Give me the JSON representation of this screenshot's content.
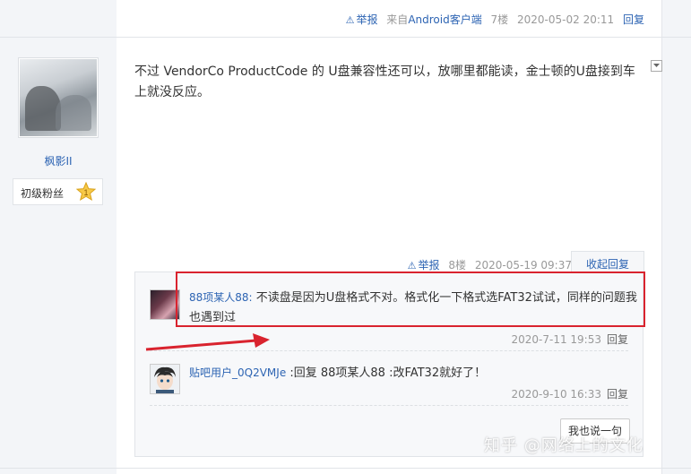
{
  "floor7": {
    "report": "举报",
    "source_prefix": "来自",
    "source_client": "Android客户端",
    "floor": "7楼",
    "time": "2020-05-02 20:11",
    "reply": "回复"
  },
  "post": {
    "user": {
      "name": "枫影II",
      "level": "初级粉丝",
      "level_num": "1"
    },
    "content": "不过 VendorCo ProductCode 的 U盘兼容性还可以，放哪里都能读，金士顿的U盘接到车上就没反应。",
    "report": "举报",
    "floor": "8楼",
    "time": "2020-05-19 09:37",
    "collapse": "收起回复"
  },
  "replies": [
    {
      "user": "88项某人88:",
      "text": " 不读盘是因为U盘格式不对。格式化一下格式选FAT32试试，同样的问题我也遇到过",
      "time": "2020-7-11 19:53",
      "action": "回复"
    },
    {
      "user": "贴吧用户_0Q2VMJe",
      "text": " :回复 88项某人88 :改FAT32就好了！",
      "time": "2020-9-10 16:33",
      "action": "回复"
    }
  ],
  "say_button": "我也说一句",
  "watermark": "知乎 @网络上的文化",
  "colors": {
    "link": "#2d64b3",
    "highlight": "#d9232e",
    "sidebar_bg": "#f3f5f8"
  }
}
